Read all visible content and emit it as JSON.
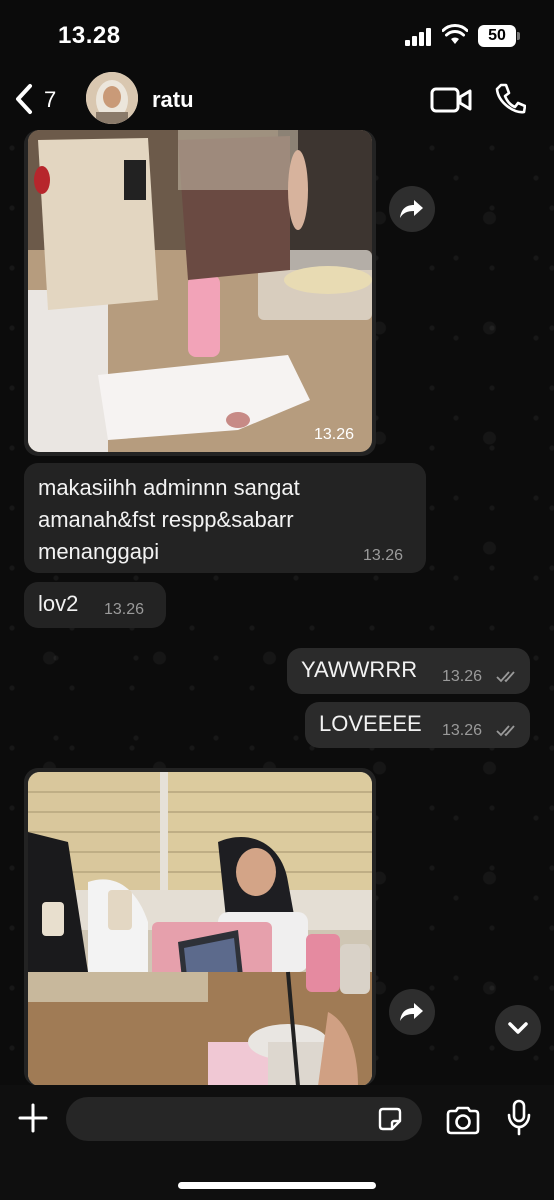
{
  "status": {
    "time": "13.28",
    "battery": "50"
  },
  "header": {
    "back_count": "7",
    "contact_name": "ratu"
  },
  "messages": [
    {
      "type": "image",
      "direction": "incoming",
      "time": "13.26",
      "photo": "two iced drinks held up over a desk"
    },
    {
      "type": "text",
      "direction": "incoming",
      "text_line1": "makasiihh adminnn sangat",
      "text_line2": "amanah&fst respp&sabarr",
      "text_line3": "menanggapi",
      "time": "13.26"
    },
    {
      "type": "text",
      "direction": "incoming",
      "text": "lov2",
      "time": "13.26"
    },
    {
      "type": "text",
      "direction": "outgoing",
      "text": "YAWWRRR",
      "time": "13.26",
      "status": "read"
    },
    {
      "type": "text",
      "direction": "outgoing",
      "text": "LOVEEEE",
      "time": "13.26",
      "status": "read"
    },
    {
      "type": "image",
      "direction": "incoming",
      "photo": "people in a classroom with drinks and laptop"
    }
  ],
  "composer": {
    "placeholder": ""
  },
  "icons": {
    "back": "chevron-left-icon",
    "video": "video-call-icon",
    "phone": "phone-icon",
    "forward": "forward-icon",
    "scroll": "chevron-down-icon",
    "plus": "plus-icon",
    "sticker": "sticker-icon",
    "camera": "camera-icon",
    "mic": "microphone-icon"
  },
  "colors": {
    "background": "#0b0b0b",
    "bubble_incoming": "#232323",
    "bubble_outgoing": "#2b2b2b",
    "timestamp": "#9a9a9a"
  }
}
